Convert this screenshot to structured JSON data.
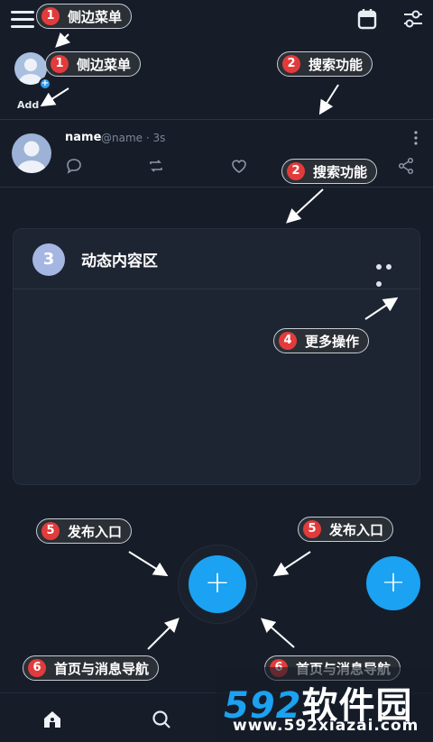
{
  "header": {
    "menu_icon": "hamburger-menu-icon",
    "calendar_icon": "calendar-icon",
    "filter_icon": "sliders-icon"
  },
  "story": {
    "add_label": "Add"
  },
  "post": {
    "name": "name",
    "handle": "@name · 3s",
    "actions": [
      "reply-icon",
      "repost-icon",
      "like-icon",
      "share-icon"
    ]
  },
  "card": {
    "number": "3",
    "title": "动态内容区"
  },
  "fab": {
    "label": "+"
  },
  "fab_secondary": {
    "label": "+"
  },
  "bottom_nav": [
    "home-icon",
    "search-icon"
  ],
  "callouts": [
    {
      "num": "1",
      "text": "侧边菜单"
    },
    {
      "num": "1",
      "text": "侧边菜单"
    },
    {
      "num": "2",
      "text": "搜索功能"
    },
    {
      "num": "2",
      "text": "搜索功能"
    },
    {
      "num": "4",
      "text": "更多操作"
    },
    {
      "num": "5",
      "text": "发布入口"
    },
    {
      "num": "5",
      "text": "发布入口"
    },
    {
      "num": "6",
      "text": "首页与消息导航"
    },
    {
      "num": "6",
      "text": "首页与消息导航"
    }
  ],
  "watermark": {
    "brand_num": "592",
    "brand_text": "软件园",
    "url": "www.592xiazai.com"
  },
  "colors": {
    "background": "#161d28",
    "accent": "#1ba2f2",
    "callout_badge": "#e23b3b"
  }
}
